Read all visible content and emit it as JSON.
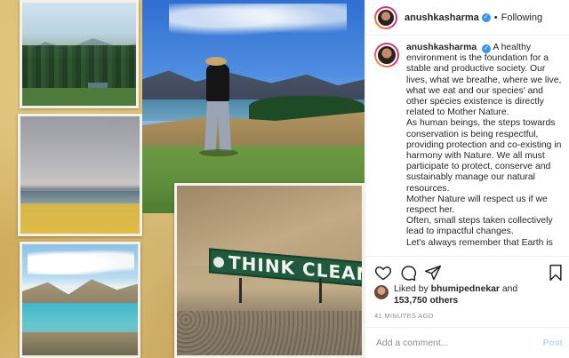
{
  "post": {
    "username": "anushkasharma",
    "follow_status": "Following",
    "separator": "•",
    "caption_lines": [
      "A healthy environment is the foundation for a stable and productive society. Our lives, what we breathe, where we live, what we eat and our species' and other species existence is directly related to Mother Nature.",
      "As human beings, the steps towards conservation is being respectful, providing protection and co-existing in harmony with Nature. We all must participate to protect, conserve and sustainably manage our natural resources.",
      "Mother Nature will respect us if we respect her.",
      "Often, small steps taken collectively lead to impactful changes.",
      "Let's always remember that Earth is"
    ],
    "liked_by_prefix": "Liked by",
    "liked_by_user": "bhumipednekar",
    "and_word": "and",
    "others_count": "153,750 others",
    "timestamp": "41 MINUTES AGO",
    "comment_placeholder": "Add a comment...",
    "post_button": "Post",
    "sign_text": "THINK CLEAN",
    "icons": [
      "heart-icon",
      "comment-icon",
      "share-icon",
      "bookmark-icon",
      "verified-badge-icon"
    ],
    "colors": {
      "verified": "#3897f0",
      "post_button": "#b2dffc",
      "timestamp": "#8e8e8e"
    }
  }
}
